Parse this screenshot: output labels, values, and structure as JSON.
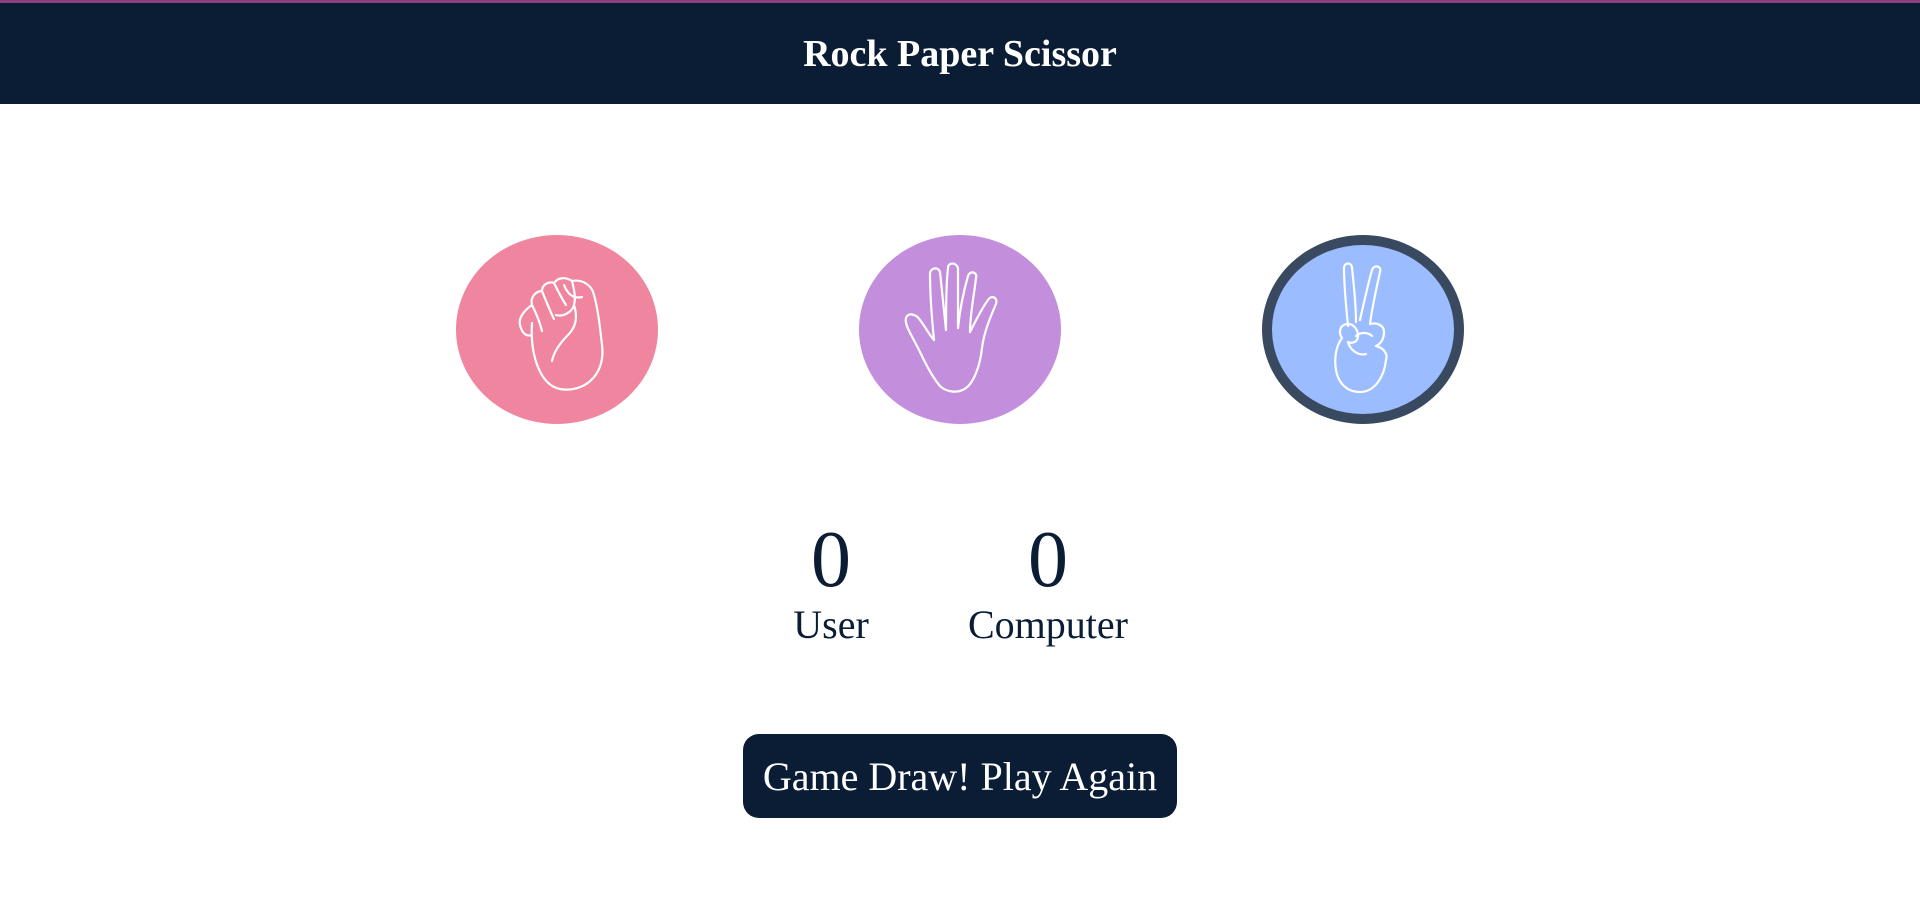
{
  "header": {
    "title": "Rock Paper Scissor"
  },
  "choices": [
    {
      "id": "rock",
      "icon": "rock-fist-icon",
      "color": "#f0859f"
    },
    {
      "id": "paper",
      "icon": "paper-hand-icon",
      "color": "#c38fdd"
    },
    {
      "id": "scissor",
      "icon": "scissor-hand-icon",
      "color": "#9bbcfe",
      "selected": true,
      "border_color": "#394a60"
    }
  ],
  "scoreboard": {
    "user": {
      "score": "0",
      "label": "User"
    },
    "computer": {
      "score": "0",
      "label": "Computer"
    }
  },
  "message": {
    "text": "Game Draw! Play Again"
  },
  "colors": {
    "header_bg": "#0b1d35",
    "accent_line": "#8e3f7e",
    "text": "#0b1d35"
  }
}
